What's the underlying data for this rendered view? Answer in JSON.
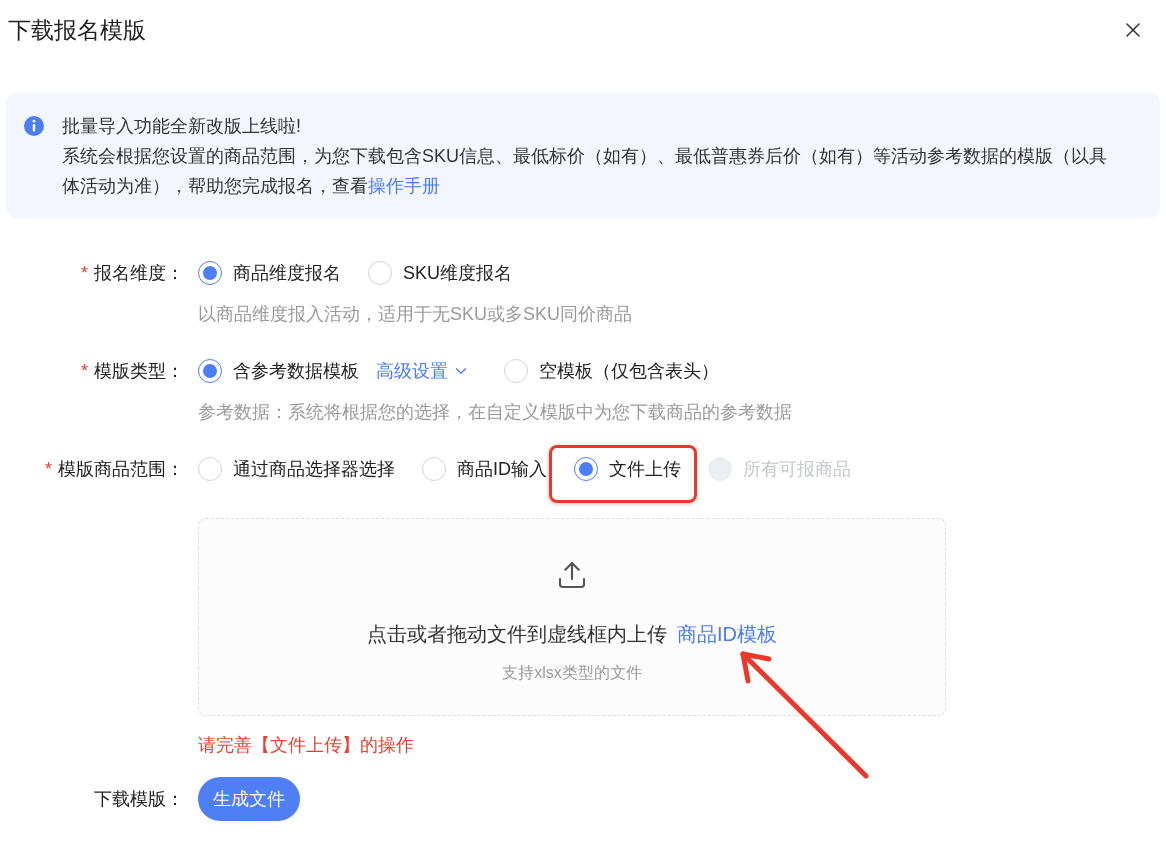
{
  "dialog": {
    "title": "下载报名模版"
  },
  "notice": {
    "heading": "批量导入功能全新改版上线啦!",
    "text": "系统会根据您设置的商品范围，为您下载包含SKU信息、最低标价（如有）、最低普惠券后价（如有）等活动参考数据的模版（以具体活动为准），帮助您完成报名，查看",
    "link": "操作手册"
  },
  "fields": [
    {
      "required_mark": "*",
      "label": "报名维度：",
      "options": [
        {
          "kind": "radio",
          "label": "商品维度报名",
          "selected": true,
          "disabled": false
        },
        {
          "kind": "radio",
          "label": "SKU维度报名",
          "selected": false,
          "disabled": false
        }
      ],
      "help": "以商品维度报入活动，适用于无SKU或多SKU同价商品"
    },
    {
      "required_mark": "*",
      "label": "模版类型：",
      "options": [
        {
          "kind": "radio",
          "label": "含参考数据模板",
          "selected": true,
          "disabled": false
        },
        {
          "kind": "link",
          "label": "高级设置",
          "expanded": false
        },
        {
          "kind": "radio",
          "label": "空模板（仅包含表头）",
          "selected": false,
          "disabled": false
        }
      ],
      "help": "参考数据：系统将根据您的选择，在自定义模版中为您下载商品的参考数据"
    },
    {
      "required_mark": "*",
      "label": "模版商品范围：",
      "options": [
        {
          "kind": "radio",
          "label": "通过商品选择器选择",
          "selected": false,
          "disabled": false,
          "highlighted": false
        },
        {
          "kind": "radio",
          "label": "商品ID输入",
          "selected": false,
          "disabled": false,
          "highlighted": false
        },
        {
          "kind": "radio",
          "label": "文件上传",
          "selected": true,
          "disabled": false,
          "highlighted": true
        },
        {
          "kind": "radio",
          "label": "所有可报商品",
          "selected": false,
          "disabled": true,
          "highlighted": false
        }
      ],
      "upload": {
        "prompt": "点击或者拖动文件到虚线框内上传",
        "link": "商品ID模板",
        "hint": "支持xlsx类型的文件"
      },
      "error": "请完善【文件上传】的操作"
    }
  ],
  "download": {
    "label": "下载模版：",
    "button": "生成文件"
  },
  "annotations": [
    {
      "kind": "arrow"
    }
  ]
}
